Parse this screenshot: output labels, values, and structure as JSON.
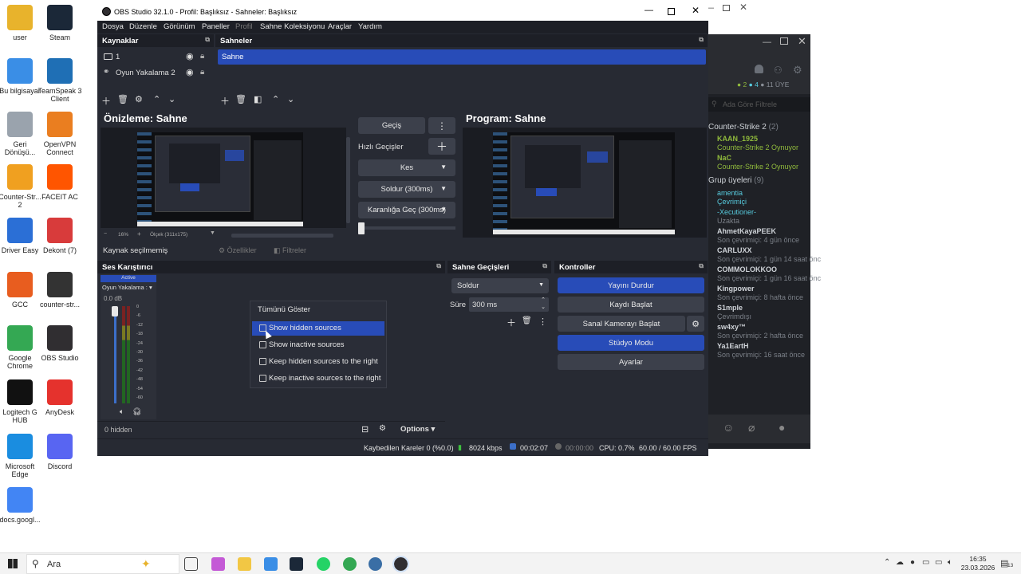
{
  "desktop": {
    "icons": [
      {
        "label": "user",
        "icon": "user-folder-icon",
        "color": "#e8b32c"
      },
      {
        "label": "Steam",
        "icon": "steam-icon",
        "color": "#1b2838"
      },
      {
        "label": "Bu bilgisayar",
        "icon": "computer-icon",
        "color": "#3a8ee6"
      },
      {
        "label": "TeamSpeak 3 Client",
        "icon": "teamspeak-icon",
        "color": "#1f6fb5"
      },
      {
        "label": "Geri Dönüşü...",
        "icon": "recycle-bin-icon",
        "color": "#9aa3ad"
      },
      {
        "label": "OpenVPN Connect",
        "icon": "openvpn-icon",
        "color": "#ea7e20"
      },
      {
        "label": "Counter-Str... 2",
        "icon": "cs2-icon",
        "color": "#f0a020"
      },
      {
        "label": "FACEIT AC",
        "icon": "faceit-icon",
        "color": "#ff5500"
      },
      {
        "label": "Driver Easy",
        "icon": "drivereasy-icon",
        "color": "#2b6fd6"
      },
      {
        "label": "Dekont (7)",
        "icon": "pdf-icon",
        "color": "#d83b3b"
      },
      {
        "label": "GCC",
        "icon": "gcc-icon",
        "color": "#e85d1f"
      },
      {
        "label": "counter-str...",
        "icon": "video-file-icon",
        "color": "#333333"
      },
      {
        "label": "Google Chrome",
        "icon": "chrome-icon",
        "color": "#34a853"
      },
      {
        "label": "OBS Studio",
        "icon": "obs-icon",
        "color": "#302e31"
      },
      {
        "label": "Logitech G HUB",
        "icon": "logitech-icon",
        "color": "#111111"
      },
      {
        "label": "AnyDesk",
        "icon": "anydesk-icon",
        "color": "#e5322d"
      },
      {
        "label": "Microsoft Edge",
        "icon": "edge-icon",
        "color": "#1a8de0"
      },
      {
        "label": "Discord",
        "icon": "discord-icon",
        "color": "#5865f2"
      },
      {
        "label": "docs.googl...",
        "icon": "chrome-shortcut-icon",
        "color": "#4285f4"
      }
    ]
  },
  "steam_friends": {
    "counts": [
      "2",
      "4",
      "11 ÜYE"
    ],
    "search_placeholder": "Ada Göre Filtrele",
    "game_group": "Counter-Strike 2",
    "game_group_count": "(2)",
    "ingame": [
      {
        "name": "KAAN_1925",
        "status": "Counter-Strike 2 Oynuyor"
      },
      {
        "name": "NaC",
        "status": "Counter-Strike 2 Oynuyor"
      }
    ],
    "group_members_label": "Grup üyeleri",
    "group_members_count": "(9)",
    "members": [
      {
        "name": "amentia",
        "status": "Çevrimiçi"
      },
      {
        "name": "-Xecutioner-",
        "status": "Uzakta"
      },
      {
        "name": "AhmetKayaPEEK",
        "status": "Son çevrimiçi: 4 gün önce"
      },
      {
        "name": "CARLUXX",
        "status": "Son çevrimiçi: 1 gün 14 saat önc"
      },
      {
        "name": "COMMOLOKKOO",
        "status": "Son çevrimiçi: 1 gün 16 saat önc"
      },
      {
        "name": "Kingpower",
        "status": "Son çevrimiçi: 8 hafta önce"
      },
      {
        "name": "S1mple",
        "status": "Çevrimdışı"
      },
      {
        "name": "sw4xy™",
        "status": "Son çevrimiçi: 2 hafta önce"
      },
      {
        "name": "Ya1EartH",
        "status": "Son çevrimiçi: 16 saat önce"
      }
    ]
  },
  "obs": {
    "title": "OBS Studio 32.1.0 - Profil: Başlıksız - Sahneler: Başlıksız",
    "menu": [
      "Dosya",
      "Düzenle",
      "Görünüm",
      "Paneller",
      "Profil",
      "Sahne Koleksiyonu",
      "Araçlar",
      "Yardım"
    ],
    "sources_header": "Kaynaklar",
    "sources": [
      {
        "name": "1",
        "icon": "monitor-icon"
      },
      {
        "name": "Oyun Yakalama 2",
        "icon": "gamepad-icon"
      }
    ],
    "scenes_header": "Sahneler",
    "scenes": [
      "Sahne"
    ],
    "preview_title": "Önizleme: Sahne",
    "program_title": "Program: Sahne",
    "zoom_label": "16%",
    "zoom_size": "Ölçek (311x175)",
    "transition_button": "Geçiş",
    "quick_transitions_label": "Hızlı Geçişler",
    "quick_transitions": [
      "Kes",
      "Soldur (300ms)",
      "Karanlığa Geç (300ms)"
    ],
    "no_source_selected": "Kaynak seçilmemiş",
    "properties_button": "Özellikler",
    "filters_button": "Filtreler",
    "mixer_header": "Ses Karıştırıcı",
    "mixer_active": "Active",
    "mixer_source": "Oyun Yakalama :",
    "mixer_db": "0.0 dB",
    "meter_ticks": [
      "0",
      "-6",
      "-12",
      "-18",
      "-24",
      "-30",
      "-36",
      "-42",
      "-48",
      "-54",
      "-60"
    ],
    "hidden_count": "0 hidden",
    "options_button": "Options",
    "context_menu": {
      "show_all": "Tümünü Göster",
      "items": [
        {
          "label": "Show hidden sources",
          "checked": false,
          "highlighted": true
        },
        {
          "label": "Show inactive sources",
          "checked": false,
          "highlighted": false
        },
        {
          "label": "Keep hidden sources to the right",
          "checked": false,
          "highlighted": false
        },
        {
          "label": "Keep inactive sources to the right",
          "checked": false,
          "highlighted": false
        }
      ]
    },
    "transitions_header": "Sahne Geçişleri",
    "transition_select": "Soldur",
    "duration_label": "Süre",
    "duration_value": "300 ms",
    "controls_header": "Kontroller",
    "controls": {
      "stop_stream": "Yayını Durdur",
      "start_record": "Kaydı Başlat",
      "virtual_cam": "Sanal Kamerayı Başlat",
      "studio_mode": "Stüdyo Modu",
      "settings": "Ayarlar"
    },
    "status": {
      "dropped": "Kaybedilen Kareler 0 (%0.0)",
      "bitrate": "8024 kbps",
      "stream_time": "00:02:07",
      "record_time": "00:00:00",
      "cpu": "CPU: 0.7%",
      "fps": "60.00 / 60.00 FPS"
    }
  },
  "taskbar": {
    "search_placeholder": "Ara",
    "time": "16:35",
    "date": "23.03.2026",
    "notification_count": "13"
  },
  "colors": {
    "accent": "#284cb8",
    "obs_bg": "#272a33",
    "panel": "#1d1f26"
  }
}
